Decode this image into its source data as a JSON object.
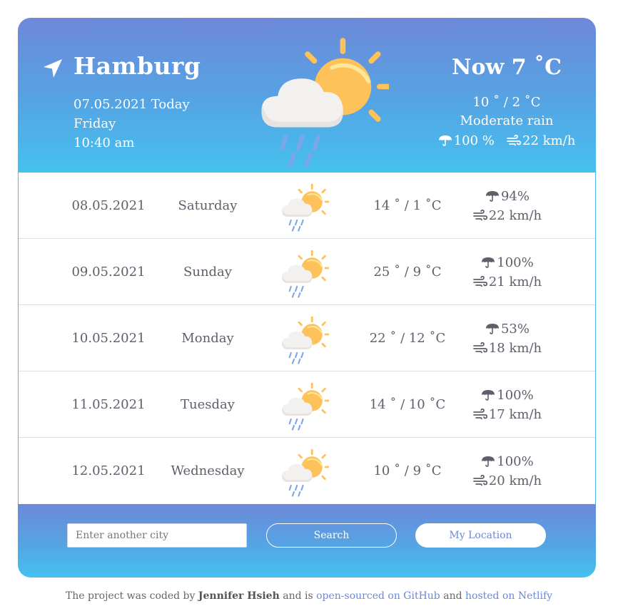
{
  "current": {
    "city": "Hamburg",
    "date_line": "07.05.2021 Today",
    "weekday": "Friday",
    "time": "10:40 am",
    "now_label": "Now 7 ˚C",
    "range": "10 ˚ / 2 ˚C",
    "description": "Moderate rain",
    "precipitation": "100 %",
    "wind": "22 km/h",
    "icon": "sun-cloud-rain-icon"
  },
  "forecast": [
    {
      "date": "08.05.2021",
      "day": "Saturday",
      "temp": "14 ˚ / 1 ˚C",
      "precip": "94%",
      "wind": "22 km/h"
    },
    {
      "date": "09.05.2021",
      "day": "Sunday",
      "temp": "25 ˚ / 9 ˚C",
      "precip": "100%",
      "wind": "21 km/h"
    },
    {
      "date": "10.05.2021",
      "day": "Monday",
      "temp": "22 ˚ / 12 ˚C",
      "precip": "53%",
      "wind": "18 km/h"
    },
    {
      "date": "11.05.2021",
      "day": "Tuesday",
      "temp": "14 ˚ / 10 ˚C",
      "precip": "100%",
      "wind": "17 km/h"
    },
    {
      "date": "12.05.2021",
      "day": "Wednesday",
      "temp": "10 ˚ / 9 ˚C",
      "precip": "100%",
      "wind": "20 km/h"
    }
  ],
  "search": {
    "placeholder": "Enter another city",
    "search_label": "Search",
    "location_label": "My Location"
  },
  "credits": {
    "text1": "The project was coded by ",
    "author": "Jennifer Hsieh",
    "text2": " and is ",
    "link1": "open-sourced on GitHub",
    "text3": " and ",
    "link2": "hosted on Netlify"
  },
  "colors": {
    "gradient_top": "#6d89d9",
    "gradient_bottom": "#45c1ef",
    "sun": "#fdc25a",
    "rain": "#7ba6e8"
  }
}
